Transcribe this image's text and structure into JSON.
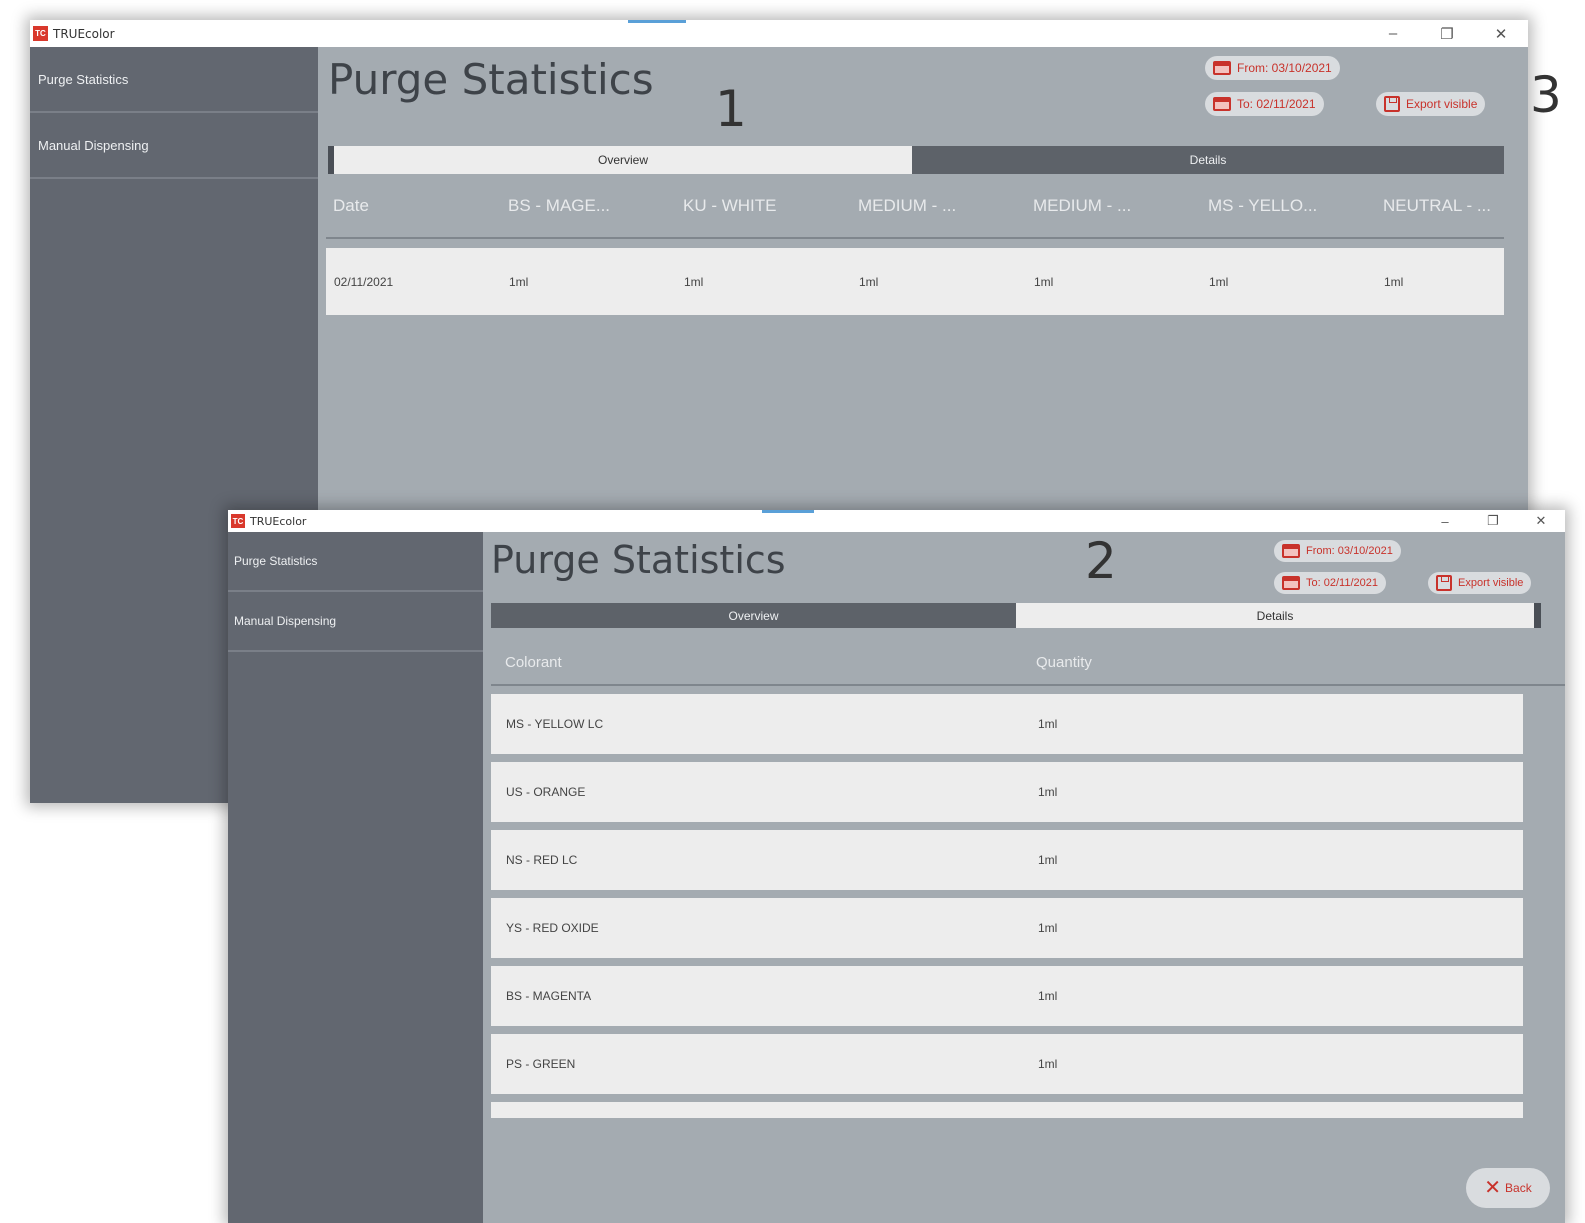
{
  "app": {
    "logo": "TC",
    "title": "TRUEcolor"
  },
  "window_controls": {
    "minimize": "–",
    "maximize": "❐",
    "close": "✕"
  },
  "sidebar": {
    "items": [
      {
        "label": "Purge Statistics"
      },
      {
        "label": "Manual Dispensing"
      }
    ]
  },
  "page_title": "Purge Statistics",
  "filters": {
    "from_label": "From: 03/10/2021",
    "to_label": "To: 02/11/2021",
    "export_label": "Export visible"
  },
  "tabs": [
    {
      "label": "Overview"
    },
    {
      "label": "Details"
    }
  ],
  "overview_table": {
    "columns": [
      "Date",
      "BS - MAGE...",
      "KU - WHITE",
      "MEDIUM - ...",
      "MEDIUM - ...",
      "MS - YELLO...",
      "NEUTRAL - ..."
    ],
    "rows": [
      [
        "02/11/2021",
        "1ml",
        "1ml",
        "1ml",
        "1ml",
        "1ml",
        "1ml"
      ]
    ]
  },
  "details_table": {
    "columns": [
      "Colorant",
      "Quantity"
    ],
    "rows": [
      [
        "MS - YELLOW LC",
        "1ml"
      ],
      [
        "US - ORANGE",
        "1ml"
      ],
      [
        "NS - RED LC",
        "1ml"
      ],
      [
        "YS - RED OXIDE",
        "1ml"
      ],
      [
        "BS - MAGENTA",
        "1ml"
      ],
      [
        "PS - GREEN",
        "1ml"
      ]
    ]
  },
  "back_button": {
    "label": "Back"
  },
  "annotations": [
    "1",
    "2",
    "3"
  ],
  "colors": {
    "accent_red": "#c8322b",
    "sidebar": "#626770",
    "content_bg": "#a4abb1",
    "row_bg": "#ededed"
  }
}
